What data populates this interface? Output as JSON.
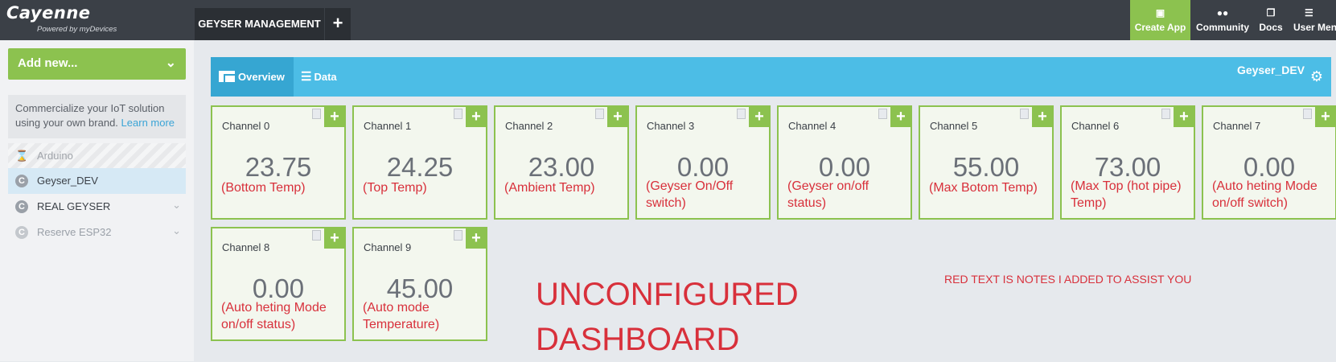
{
  "brand": {
    "name": "Cayenne",
    "tagline": "Powered by myDevices"
  },
  "project": {
    "tab_label": "GEYSER MANAGEMENT",
    "add_label": "+"
  },
  "topnav": {
    "create_app": "Create App",
    "community": "Community",
    "docs": "Docs",
    "user_menu": "User Menu"
  },
  "sidebar": {
    "add_new": "Add new...",
    "promo_line1": "Commercialize your IoT solution",
    "promo_line2": "using your own brand.",
    "promo_link": "Learn more",
    "devices": [
      {
        "name": "Arduino"
      },
      {
        "name": "Geyser_DEV"
      },
      {
        "name": "REAL GEYSER"
      },
      {
        "name": "Reserve ESP32"
      }
    ]
  },
  "dashboard": {
    "tabs": [
      "Overview",
      "Data"
    ],
    "device_name": "Geyser_DEV"
  },
  "channels": [
    {
      "title": "Channel 0",
      "value": "23.75",
      "note_lines": [
        "(Bottom Temp)"
      ]
    },
    {
      "title": "Channel 1",
      "value": "24.25",
      "note_lines": [
        "(Top Temp)"
      ]
    },
    {
      "title": "Channel 2",
      "value": "23.00",
      "note_lines": [
        "(Ambient Temp)"
      ]
    },
    {
      "title": "Channel 3",
      "value": "0.00",
      "note_lines": [
        "(Geyser On/Off",
        "switch)"
      ]
    },
    {
      "title": "Channel 4",
      "value": "0.00",
      "note_lines": [
        "(Geyser on/off",
        "status)"
      ]
    },
    {
      "title": "Channel 5",
      "value": "55.00",
      "note_lines": [
        "(Max Botom Temp)"
      ]
    },
    {
      "title": "Channel 6",
      "value": "73.00",
      "note_lines": [
        "(Max Top (hot pipe)",
        "Temp)"
      ]
    },
    {
      "title": "Channel 7",
      "value": "0.00",
      "note_lines": [
        "(Auto heting Mode",
        "on/off switch)"
      ]
    },
    {
      "title": "Channel 8",
      "value": "0.00",
      "note_lines": [
        "(Auto heting Mode",
        "on/off status)"
      ]
    },
    {
      "title": "Channel 9",
      "value": "45.00",
      "note_lines": [
        "(Auto mode",
        "Temperature)"
      ]
    }
  ],
  "notes": {
    "unconfigured_line1": "UNCONFIGURED",
    "unconfigured_line2": "DASHBOARD",
    "red_text": "RED TEXT IS NOTES I ADDED TO ASSIST YOU"
  },
  "colors": {
    "accent_green": "#8cc24f",
    "dash_blue": "#4cbde6",
    "note_red": "#d8303b",
    "topbar": "#3b4047"
  }
}
